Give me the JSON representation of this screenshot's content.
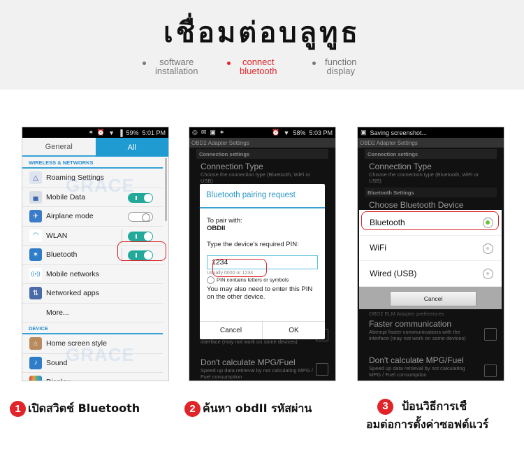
{
  "header": {
    "title": "เชื่อมต่อบลูทูธ",
    "steps": [
      {
        "line1": "software",
        "line2": "installation",
        "active": false
      },
      {
        "line1": "connect",
        "line2": "bluetooth",
        "active": true
      },
      {
        "line1": "function",
        "line2": "display",
        "active": false
      }
    ],
    "accent_color": "#e0242a"
  },
  "phone1": {
    "status": {
      "battery": "59%",
      "time": "5:01 PM"
    },
    "tabs": [
      "General",
      "All"
    ],
    "section_wireless": "WIRELESS & NETWORKS",
    "items": [
      {
        "label": "Roaming Settings",
        "icon": "triangle-icon"
      },
      {
        "label": "Mobile Data",
        "icon": "chart-icon",
        "toggle": "on"
      },
      {
        "label": "Airplane mode",
        "icon": "airplane-icon",
        "toggle": "off"
      },
      {
        "label": "WLAN",
        "icon": "wifi-icon",
        "toggle": "on"
      },
      {
        "label": "Bluetooth",
        "icon": "bluetooth-icon",
        "toggle": "on"
      },
      {
        "label": "Mobile networks",
        "icon": "signal-icon"
      },
      {
        "label": "Networked apps",
        "icon": "apps-icon"
      },
      {
        "label": "More..."
      }
    ],
    "section_device": "DEVICE",
    "device_items": [
      {
        "label": "Home screen style",
        "icon": "home-icon"
      },
      {
        "label": "Sound",
        "icon": "speaker-icon"
      },
      {
        "label": "Display",
        "icon": "display-icon"
      }
    ]
  },
  "phone2": {
    "status": {
      "battery": "58%",
      "time": "5:03 PM"
    },
    "appbar": "OBD2 Adapter Settings",
    "subhead": "Connection settings",
    "pref1_title": "Connection Type",
    "pref1_desc": "Choose the connection type (Bluetooth, WiFi or USB)",
    "dialog": {
      "title": "Bluetooth pairing request",
      "pair_with_label": "To pair with:",
      "device": "OBDII",
      "pin_prompt": "Type the device's required PIN:",
      "pin_value": "1234",
      "hint": "Usually 0000 or 1234",
      "checkbox_label": "PIN contains letters or symbols",
      "note": "You may also need to enter this PIN on the other device.",
      "cancel": "Cancel",
      "ok": "OK"
    },
    "pref2_desc": "interface (may not work on some devices)",
    "pref3_title": "Don't calculate MPG/Fuel",
    "pref3_desc": "Speed up data retrieval by not calculating MPG / Fuel consumption"
  },
  "phone3": {
    "status_text": "Saving screenshot...",
    "appbar": "OBD2 Adapter Settings",
    "subhead": "Connection settings",
    "pref1_title": "Connection Type",
    "pref1_desc": "Choose the connection type (Bluetooth, WiFi or USB)",
    "subhead2": "Bluetooth Settings",
    "pref_choose": "Choose Bluetooth Device",
    "options": [
      {
        "label": "Bluetooth",
        "selected": true
      },
      {
        "label": "WiFi",
        "selected": false
      },
      {
        "label": "Wired (USB)",
        "selected": false
      }
    ],
    "cancel": "Cancel",
    "subhead3": "OBD2 ELM Adapter preferences",
    "pref2_title": "Faster communication",
    "pref2_desc": "Attempt faster communications with the interface (may not work on some devices)",
    "pref3_title": "Don't calculate MPG/Fuel",
    "pref3_desc": "Speed up data retrieval by not calculating MPG / Fuel consumption"
  },
  "captions": [
    {
      "num": "1",
      "text": "เปิดสวิตช์ Bluetooth"
    },
    {
      "num": "2",
      "text": "ค้นหา obdII รหัสผ่าน"
    },
    {
      "num": "3",
      "line1": "ป้อนวิธีการเชื",
      "line2": "อมต่อการตั้งค่าซอฟต์แวร์"
    }
  ],
  "watermark": "GRACE"
}
